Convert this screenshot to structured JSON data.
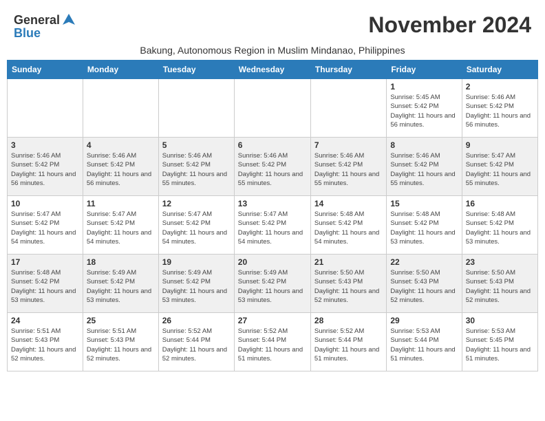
{
  "header": {
    "logo_general": "General",
    "logo_blue": "Blue",
    "month_title": "November 2024",
    "subtitle": "Bakung, Autonomous Region in Muslim Mindanao, Philippines"
  },
  "weekdays": [
    "Sunday",
    "Monday",
    "Tuesday",
    "Wednesday",
    "Thursday",
    "Friday",
    "Saturday"
  ],
  "weeks": [
    [
      {
        "day": "",
        "info": ""
      },
      {
        "day": "",
        "info": ""
      },
      {
        "day": "",
        "info": ""
      },
      {
        "day": "",
        "info": ""
      },
      {
        "day": "",
        "info": ""
      },
      {
        "day": "1",
        "info": "Sunrise: 5:45 AM\nSunset: 5:42 PM\nDaylight: 11 hours and 56 minutes."
      },
      {
        "day": "2",
        "info": "Sunrise: 5:46 AM\nSunset: 5:42 PM\nDaylight: 11 hours and 56 minutes."
      }
    ],
    [
      {
        "day": "3",
        "info": "Sunrise: 5:46 AM\nSunset: 5:42 PM\nDaylight: 11 hours and 56 minutes."
      },
      {
        "day": "4",
        "info": "Sunrise: 5:46 AM\nSunset: 5:42 PM\nDaylight: 11 hours and 56 minutes."
      },
      {
        "day": "5",
        "info": "Sunrise: 5:46 AM\nSunset: 5:42 PM\nDaylight: 11 hours and 55 minutes."
      },
      {
        "day": "6",
        "info": "Sunrise: 5:46 AM\nSunset: 5:42 PM\nDaylight: 11 hours and 55 minutes."
      },
      {
        "day": "7",
        "info": "Sunrise: 5:46 AM\nSunset: 5:42 PM\nDaylight: 11 hours and 55 minutes."
      },
      {
        "day": "8",
        "info": "Sunrise: 5:46 AM\nSunset: 5:42 PM\nDaylight: 11 hours and 55 minutes."
      },
      {
        "day": "9",
        "info": "Sunrise: 5:47 AM\nSunset: 5:42 PM\nDaylight: 11 hours and 55 minutes."
      }
    ],
    [
      {
        "day": "10",
        "info": "Sunrise: 5:47 AM\nSunset: 5:42 PM\nDaylight: 11 hours and 54 minutes."
      },
      {
        "day": "11",
        "info": "Sunrise: 5:47 AM\nSunset: 5:42 PM\nDaylight: 11 hours and 54 minutes."
      },
      {
        "day": "12",
        "info": "Sunrise: 5:47 AM\nSunset: 5:42 PM\nDaylight: 11 hours and 54 minutes."
      },
      {
        "day": "13",
        "info": "Sunrise: 5:47 AM\nSunset: 5:42 PM\nDaylight: 11 hours and 54 minutes."
      },
      {
        "day": "14",
        "info": "Sunrise: 5:48 AM\nSunset: 5:42 PM\nDaylight: 11 hours and 54 minutes."
      },
      {
        "day": "15",
        "info": "Sunrise: 5:48 AM\nSunset: 5:42 PM\nDaylight: 11 hours and 53 minutes."
      },
      {
        "day": "16",
        "info": "Sunrise: 5:48 AM\nSunset: 5:42 PM\nDaylight: 11 hours and 53 minutes."
      }
    ],
    [
      {
        "day": "17",
        "info": "Sunrise: 5:48 AM\nSunset: 5:42 PM\nDaylight: 11 hours and 53 minutes."
      },
      {
        "day": "18",
        "info": "Sunrise: 5:49 AM\nSunset: 5:42 PM\nDaylight: 11 hours and 53 minutes."
      },
      {
        "day": "19",
        "info": "Sunrise: 5:49 AM\nSunset: 5:42 PM\nDaylight: 11 hours and 53 minutes."
      },
      {
        "day": "20",
        "info": "Sunrise: 5:49 AM\nSunset: 5:42 PM\nDaylight: 11 hours and 53 minutes."
      },
      {
        "day": "21",
        "info": "Sunrise: 5:50 AM\nSunset: 5:43 PM\nDaylight: 11 hours and 52 minutes."
      },
      {
        "day": "22",
        "info": "Sunrise: 5:50 AM\nSunset: 5:43 PM\nDaylight: 11 hours and 52 minutes."
      },
      {
        "day": "23",
        "info": "Sunrise: 5:50 AM\nSunset: 5:43 PM\nDaylight: 11 hours and 52 minutes."
      }
    ],
    [
      {
        "day": "24",
        "info": "Sunrise: 5:51 AM\nSunset: 5:43 PM\nDaylight: 11 hours and 52 minutes."
      },
      {
        "day": "25",
        "info": "Sunrise: 5:51 AM\nSunset: 5:43 PM\nDaylight: 11 hours and 52 minutes."
      },
      {
        "day": "26",
        "info": "Sunrise: 5:52 AM\nSunset: 5:44 PM\nDaylight: 11 hours and 52 minutes."
      },
      {
        "day": "27",
        "info": "Sunrise: 5:52 AM\nSunset: 5:44 PM\nDaylight: 11 hours and 51 minutes."
      },
      {
        "day": "28",
        "info": "Sunrise: 5:52 AM\nSunset: 5:44 PM\nDaylight: 11 hours and 51 minutes."
      },
      {
        "day": "29",
        "info": "Sunrise: 5:53 AM\nSunset: 5:44 PM\nDaylight: 11 hours and 51 minutes."
      },
      {
        "day": "30",
        "info": "Sunrise: 5:53 AM\nSunset: 5:45 PM\nDaylight: 11 hours and 51 minutes."
      }
    ]
  ]
}
